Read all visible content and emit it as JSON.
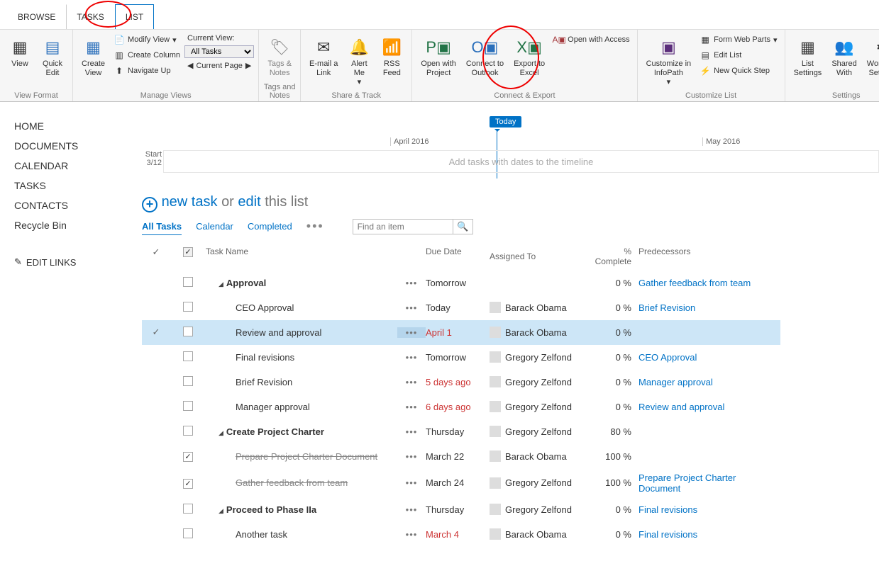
{
  "tabs": {
    "browse": "BROWSE",
    "tasks": "TASKS",
    "list": "LIST"
  },
  "ribbon": {
    "view_format": {
      "label": "View Format",
      "view": "View",
      "quick_edit": "Quick\nEdit"
    },
    "manage_views": {
      "label": "Manage Views",
      "create_view": "Create\nView",
      "modify_view": "Modify View",
      "create_column": "Create Column",
      "navigate_up": "Navigate Up",
      "current_view": "Current View:",
      "view_selector": "All Tasks",
      "current_page": "Current Page"
    },
    "tags_notes": {
      "label": "Tags and Notes",
      "btn": "Tags &\nNotes"
    },
    "share_track": {
      "label": "Share & Track",
      "email": "E-mail a\nLink",
      "alert": "Alert\nMe",
      "rss": "RSS\nFeed"
    },
    "connect_export": {
      "label": "Connect & Export",
      "project": "Open with\nProject",
      "outlook": "Connect to\nOutlook",
      "excel": "Export to\nExcel",
      "access": "Open with Access"
    },
    "customize": {
      "label": "Customize List",
      "infopath": "Customize in\nInfoPath",
      "form_web_parts": "Form Web Parts",
      "edit_list": "Edit List",
      "new_quick_step": "New Quick Step"
    },
    "settings": {
      "label": "Settings",
      "list_settings": "List\nSettings",
      "shared_with": "Shared\nWith",
      "workflow_settings": "Workflow\nSettings"
    }
  },
  "sidebar": {
    "items": [
      "HOME",
      "DOCUMENTS",
      "CALENDAR",
      "TASKS",
      "CONTACTS",
      "Recycle Bin"
    ],
    "edit_links": "EDIT LINKS"
  },
  "timeline": {
    "today": "Today",
    "month1": "April 2016",
    "month2": "May 2016",
    "start_label": "Start",
    "start_date": "3/12",
    "placeholder": "Add tasks with dates to the timeline"
  },
  "newtask": {
    "new_task": "new task",
    "or": "or",
    "edit": "edit",
    "this_list": "this list"
  },
  "viewtabs": {
    "all": "All Tasks",
    "calendar": "Calendar",
    "completed": "Completed"
  },
  "search": {
    "placeholder": "Find an item"
  },
  "columns": {
    "task_name": "Task Name",
    "due_date": "Due Date",
    "assigned_to": "Assigned To",
    "pct_complete": "% Complete",
    "predecessors": "Predecessors"
  },
  "rows": [
    {
      "indent": 1,
      "caret": true,
      "bold": true,
      "name": "Approval",
      "due": "Tomorrow",
      "assigned": "",
      "pct": "0 %",
      "pred": "Gather feedback from team"
    },
    {
      "indent": 2,
      "name": "CEO Approval",
      "due": "Today",
      "assigned": "Barack Obama",
      "pct": "0 %",
      "pred": "Brief Revision"
    },
    {
      "indent": 2,
      "name": "Review and approval",
      "due": "April 1",
      "overdue": true,
      "assigned": "Barack Obama",
      "pct": "0 %",
      "pred": "",
      "selected": true,
      "checkMark": true
    },
    {
      "indent": 2,
      "name": "Final revisions",
      "due": "Tomorrow",
      "assigned": "Gregory Zelfond",
      "pct": "0 %",
      "pred": "CEO Approval"
    },
    {
      "indent": 2,
      "name": "Brief Revision",
      "due": "5 days ago",
      "overdue": true,
      "assigned": "Gregory Zelfond",
      "pct": "0 %",
      "pred": "Manager approval"
    },
    {
      "indent": 2,
      "name": "Manager approval",
      "due": "6 days ago",
      "overdue": true,
      "assigned": "Gregory Zelfond",
      "pct": "0 %",
      "pred": "Review and approval"
    },
    {
      "indent": 1,
      "caret": true,
      "bold": true,
      "name": "Create Project Charter",
      "due": "Thursday",
      "assigned": "Gregory Zelfond",
      "pct": "80 %",
      "pred": ""
    },
    {
      "indent": 2,
      "name": "Prepare Project Charter Document",
      "strike": true,
      "done": true,
      "due": "March 22",
      "assigned": "Barack Obama",
      "pct": "100 %",
      "pred": ""
    },
    {
      "indent": 2,
      "name": "Gather feedback from team",
      "strike": true,
      "done": true,
      "due": "March 24",
      "assigned": "Gregory Zelfond",
      "pct": "100 %",
      "pred": "Prepare Project Charter Document"
    },
    {
      "indent": 1,
      "caret": true,
      "bold": true,
      "name": "Proceed to Phase IIa",
      "due": "Thursday",
      "assigned": "Gregory Zelfond",
      "pct": "0 %",
      "pred": "Final revisions"
    },
    {
      "indent": 2,
      "name": "Another task",
      "due": "March 4",
      "overdue": true,
      "assigned": "Barack Obama",
      "pct": "0 %",
      "pred": "Final revisions"
    }
  ]
}
